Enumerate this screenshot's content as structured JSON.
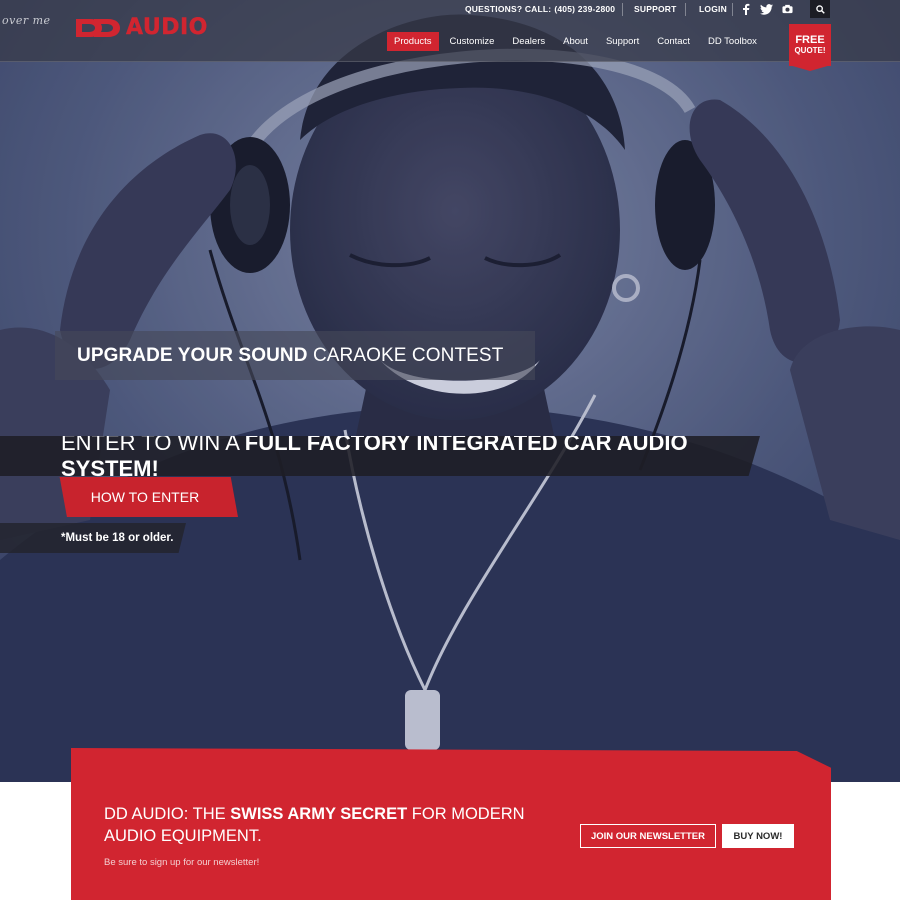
{
  "header": {
    "script_logo": "over me",
    "brand_text": "AUDIO",
    "questions_label": "QUESTIONS? CALL:",
    "phone": "(405) 239-2800",
    "support_label": "SUPPORT",
    "login_label": "LOGIN",
    "social": [
      "facebook-icon",
      "twitter-icon",
      "camera-icon"
    ],
    "search_icon": "search-icon"
  },
  "nav": {
    "items": [
      {
        "label": "Products",
        "active": true
      },
      {
        "label": "Customize",
        "active": false
      },
      {
        "label": "Dealers",
        "active": false
      },
      {
        "label": "About",
        "active": false
      },
      {
        "label": "Support",
        "active": false
      },
      {
        "label": "Contact",
        "active": false
      },
      {
        "label": "DD Toolbox",
        "active": false
      }
    ]
  },
  "free_quote": {
    "line1": "FREE",
    "line2": "QUOTE!"
  },
  "hero": {
    "banner1_bold": "UPGRADE YOUR SOUND",
    "banner1_rest": "CARAOKE CONTEST",
    "banner2_lead": "ENTER TO WIN A",
    "banner2_bold": "FULL FACTORY INTEGRATED CAR AUDIO SYSTEM!",
    "how_to_enter": "HOW TO ENTER",
    "age_note": "*Must be 18 or older."
  },
  "cta": {
    "title_lead": "DD AUDIO: THE",
    "title_bold": "SWISS ARMY SECRET",
    "title_rest": "FOR MODERN AUDIO EQUIPMENT.",
    "subtitle": "Be sure to sign up for our newsletter!",
    "newsletter_button": "JOIN OUR NEWSLETTER",
    "buy_button": "BUY NOW!"
  },
  "colors": {
    "brand_red": "#d12530",
    "topbar": "#373a48",
    "hero_blue": "#3a4263"
  }
}
